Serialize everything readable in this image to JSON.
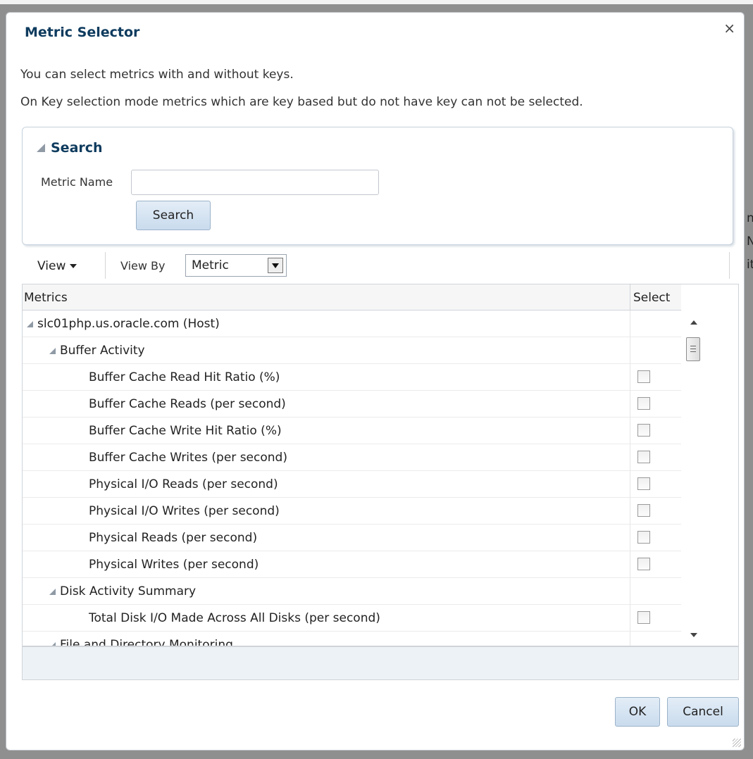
{
  "dialog": {
    "title": "Metric Selector",
    "close_icon": "×",
    "desc_line1": "You can select metrics with and without keys.",
    "desc_line2": "On Key selection mode metrics which are key based but do not have key can not be selected."
  },
  "search": {
    "header": "Search",
    "metric_name_label": "Metric Name",
    "metric_name_value": "",
    "button_label": "Search"
  },
  "toolbar": {
    "view_menu": "View",
    "view_by_label": "View By",
    "view_by_value": "Metric"
  },
  "table": {
    "col_metrics": "Metrics",
    "col_select": "Select",
    "rows": [
      {
        "label": "slc01php.us.oracle.com (Host)",
        "level": 0,
        "type": "group"
      },
      {
        "label": "Buffer Activity",
        "level": 1,
        "type": "group"
      },
      {
        "label": "Buffer Cache Read Hit Ratio (%)",
        "level": 2,
        "type": "metric",
        "checked": false
      },
      {
        "label": "Buffer Cache Reads (per second)",
        "level": 2,
        "type": "metric",
        "checked": false
      },
      {
        "label": "Buffer Cache Write Hit Ratio (%)",
        "level": 2,
        "type": "metric",
        "checked": false
      },
      {
        "label": "Buffer Cache Writes (per second)",
        "level": 2,
        "type": "metric",
        "checked": false
      },
      {
        "label": "Physical I/O Reads (per second)",
        "level": 2,
        "type": "metric",
        "checked": false
      },
      {
        "label": "Physical I/O Writes (per second)",
        "level": 2,
        "type": "metric",
        "checked": false
      },
      {
        "label": "Physical Reads (per second)",
        "level": 2,
        "type": "metric",
        "checked": false
      },
      {
        "label": "Physical Writes (per second)",
        "level": 2,
        "type": "metric",
        "checked": false
      },
      {
        "label": "Disk Activity Summary",
        "level": 1,
        "type": "group"
      },
      {
        "label": "Total Disk I/O Made Across All Disks (per second)",
        "level": 2,
        "type": "metric",
        "checked": false
      },
      {
        "label": "File and Directory Monitoring",
        "level": 1,
        "type": "group"
      }
    ]
  },
  "buttons": {
    "ok": "OK",
    "cancel": "Cancel"
  },
  "background": {
    "fragments": [
      "n",
      "Ni",
      "it"
    ]
  },
  "colors": {
    "title": "#0e3b5e",
    "overlay": "#8f8f8f",
    "button_top": "#e3edf7",
    "button_bottom": "#c9dbed"
  }
}
